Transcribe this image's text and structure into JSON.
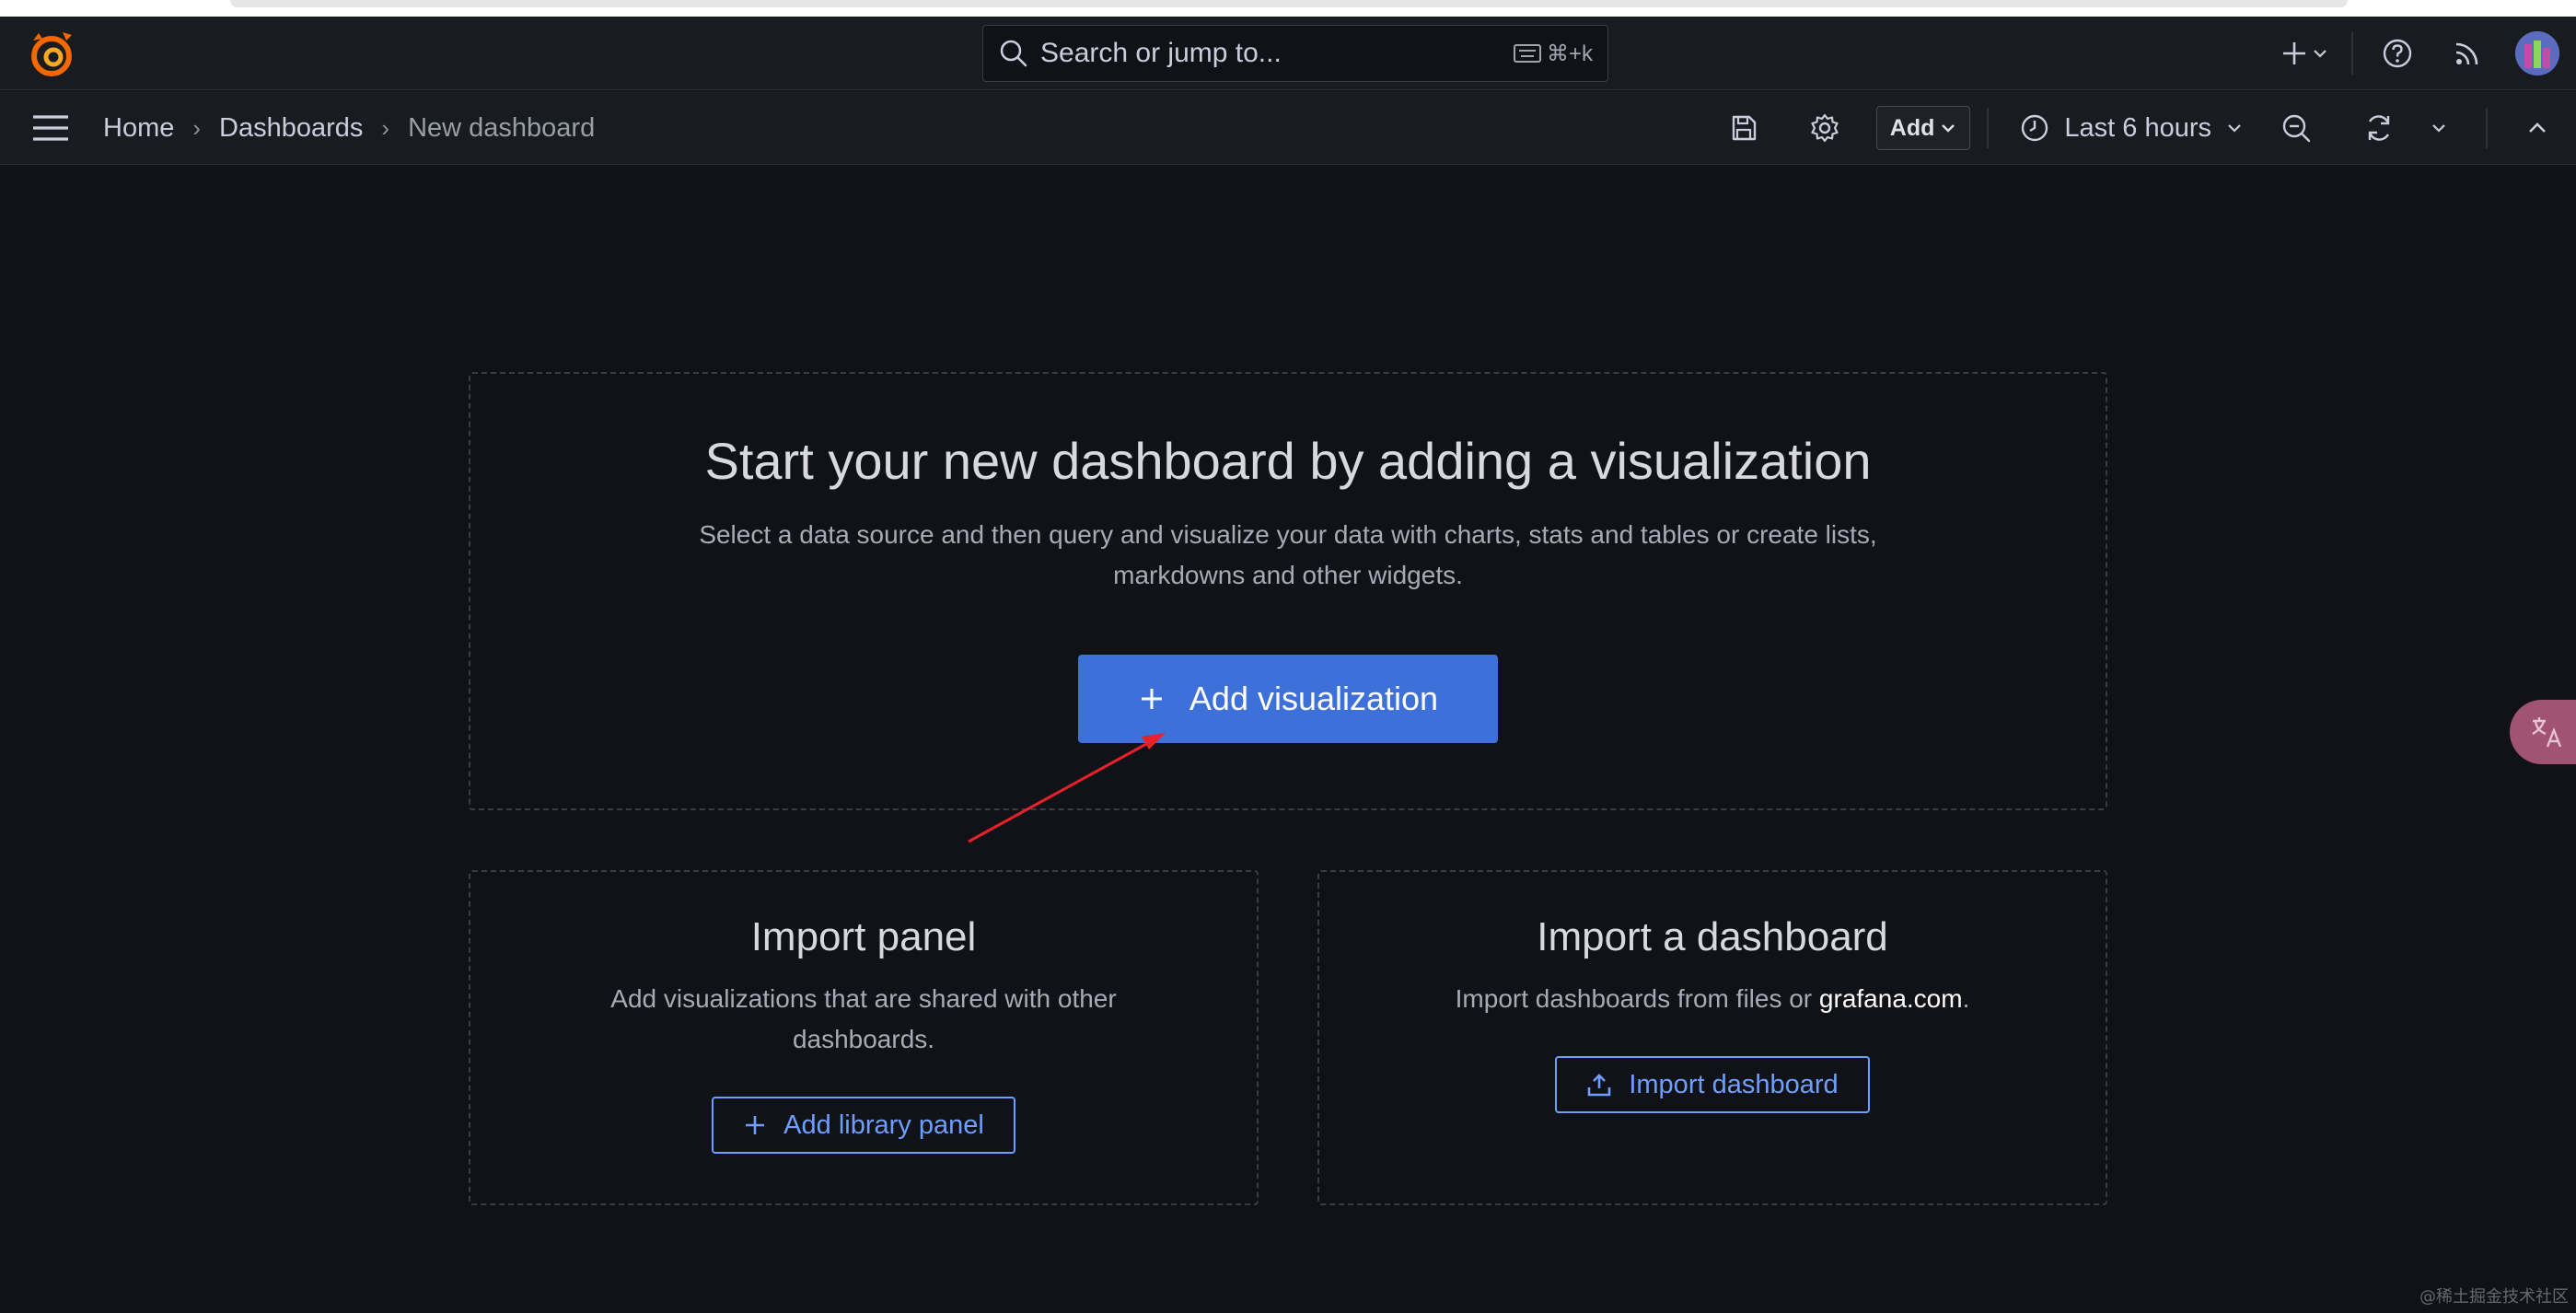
{
  "search": {
    "placeholder": "Search or jump to...",
    "shortcut": "⌘+k"
  },
  "breadcrumb": {
    "home": "Home",
    "dashboards": "Dashboards",
    "current": "New dashboard"
  },
  "toolbar": {
    "add_label": "Add",
    "time_range": "Last 6 hours"
  },
  "main": {
    "title": "Start your new dashboard by adding a visualization",
    "description_line1": "Select a data source and then query and visualize your data with charts, stats and tables or create lists,",
    "description_line2": "markdowns and other widgets.",
    "add_visualization_label": "Add visualization"
  },
  "import_panel": {
    "title": "Import panel",
    "description_line1": "Add visualizations that are shared with other",
    "description_line2": "dashboards.",
    "button_label": "Add library panel"
  },
  "import_dashboard": {
    "title": "Import a dashboard",
    "description_prefix": "Import dashboards from files or ",
    "description_link": "grafana.com",
    "description_suffix": ".",
    "button_label": "Import dashboard"
  },
  "watermark": "@稀土掘金技术社区",
  "colors": {
    "background": "#111217",
    "bar": "#181b1f",
    "primary": "#3d71d9",
    "link": "#6e9fff",
    "annotation": "#e8202a"
  }
}
